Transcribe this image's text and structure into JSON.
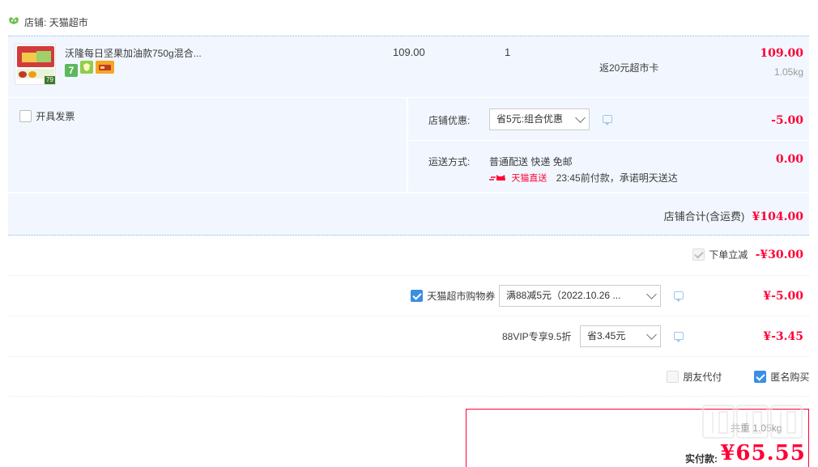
{
  "shop": {
    "label": "店铺:",
    "name": "天猫超市"
  },
  "product": {
    "title": "沃隆每日坚果加油款750g混合...",
    "price": "109.00",
    "quantity": "1",
    "promo": "返20元超市卡",
    "subtotal": "109.00",
    "weight": "1.05kg",
    "badges": [
      "7",
      "jewel-badge",
      "card-badge"
    ],
    "thumb_tag": "79"
  },
  "invoice": {
    "label": "开具发票"
  },
  "shop_discount": {
    "label": "店铺优惠:",
    "selected": "省5元:组合优惠",
    "amount": "-5.00"
  },
  "shipping": {
    "label": "运送方式:",
    "method": "普通配送 快递 免邮",
    "tmall_direct": "天猫直送",
    "promise": "23:45前付款，承诺明天送达",
    "amount": "0.00"
  },
  "shop_total": {
    "label": "店铺合计(含运费)",
    "amount": "¥104.00"
  },
  "instant_discount": {
    "label": "下单立减",
    "amount": "-¥30.00"
  },
  "coupon": {
    "label": "天猫超市购物券",
    "selected": "满88减5元（2022.10.26 ...",
    "amount": "¥-5.00"
  },
  "vip": {
    "label": "88VIP专享9.5折",
    "selected": "省3.45元",
    "amount": "¥-3.45"
  },
  "friend_pay": {
    "label": "朋友代付"
  },
  "anonymous": {
    "label": "匿名购买"
  },
  "summary": {
    "paid_label": "实付款:",
    "paid_amount": "¥65.55",
    "total_note": "共重 1.05kg"
  },
  "watermark": "值 什么值得买",
  "colors": {
    "accent": "#ff0036",
    "panel_bg": "#f2f7ff",
    "checkbox": "#3a8ee6"
  }
}
